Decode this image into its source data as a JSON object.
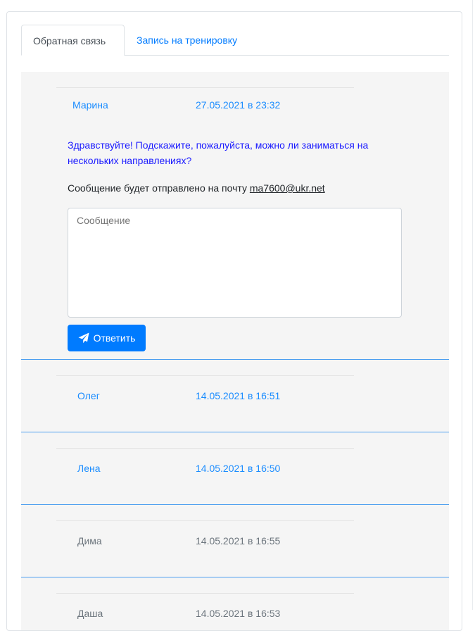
{
  "tabs": [
    {
      "label": "Обратная связь",
      "active": true
    },
    {
      "label": "Запись на тренировку",
      "active": false
    }
  ],
  "messages": [
    {
      "name": "Марина",
      "datetime": "27.05.2021 в 23:32",
      "text": "Здравствуйте! Подскажите, пожалуйста, можно ли заниматься на нескольких направлениях?",
      "notice_prefix": "Сообщение будет отправлено на почту",
      "email": "ma7600@ukr.net",
      "reply_placeholder": "Сообщение",
      "reply_button": "Ответить",
      "reply_icon": "paper-plane-icon",
      "expanded": true
    },
    {
      "name": "Олег",
      "datetime": "14.05.2021 в 16:51",
      "unread": true
    },
    {
      "name": "Лена",
      "datetime": "14.05.2021 в 16:50",
      "unread": true
    },
    {
      "name": "Дима",
      "datetime": "14.05.2021 в 16:55",
      "unread": false
    },
    {
      "name": "Даша",
      "datetime": "14.05.2021 в 16:53",
      "unread": false
    }
  ],
  "colors": {
    "accent": "#007bff",
    "unread_text": "#1a8cff",
    "read_text": "#6c757d",
    "item_background": "#f5f5f5",
    "item_divider": "#4d9ff0"
  }
}
